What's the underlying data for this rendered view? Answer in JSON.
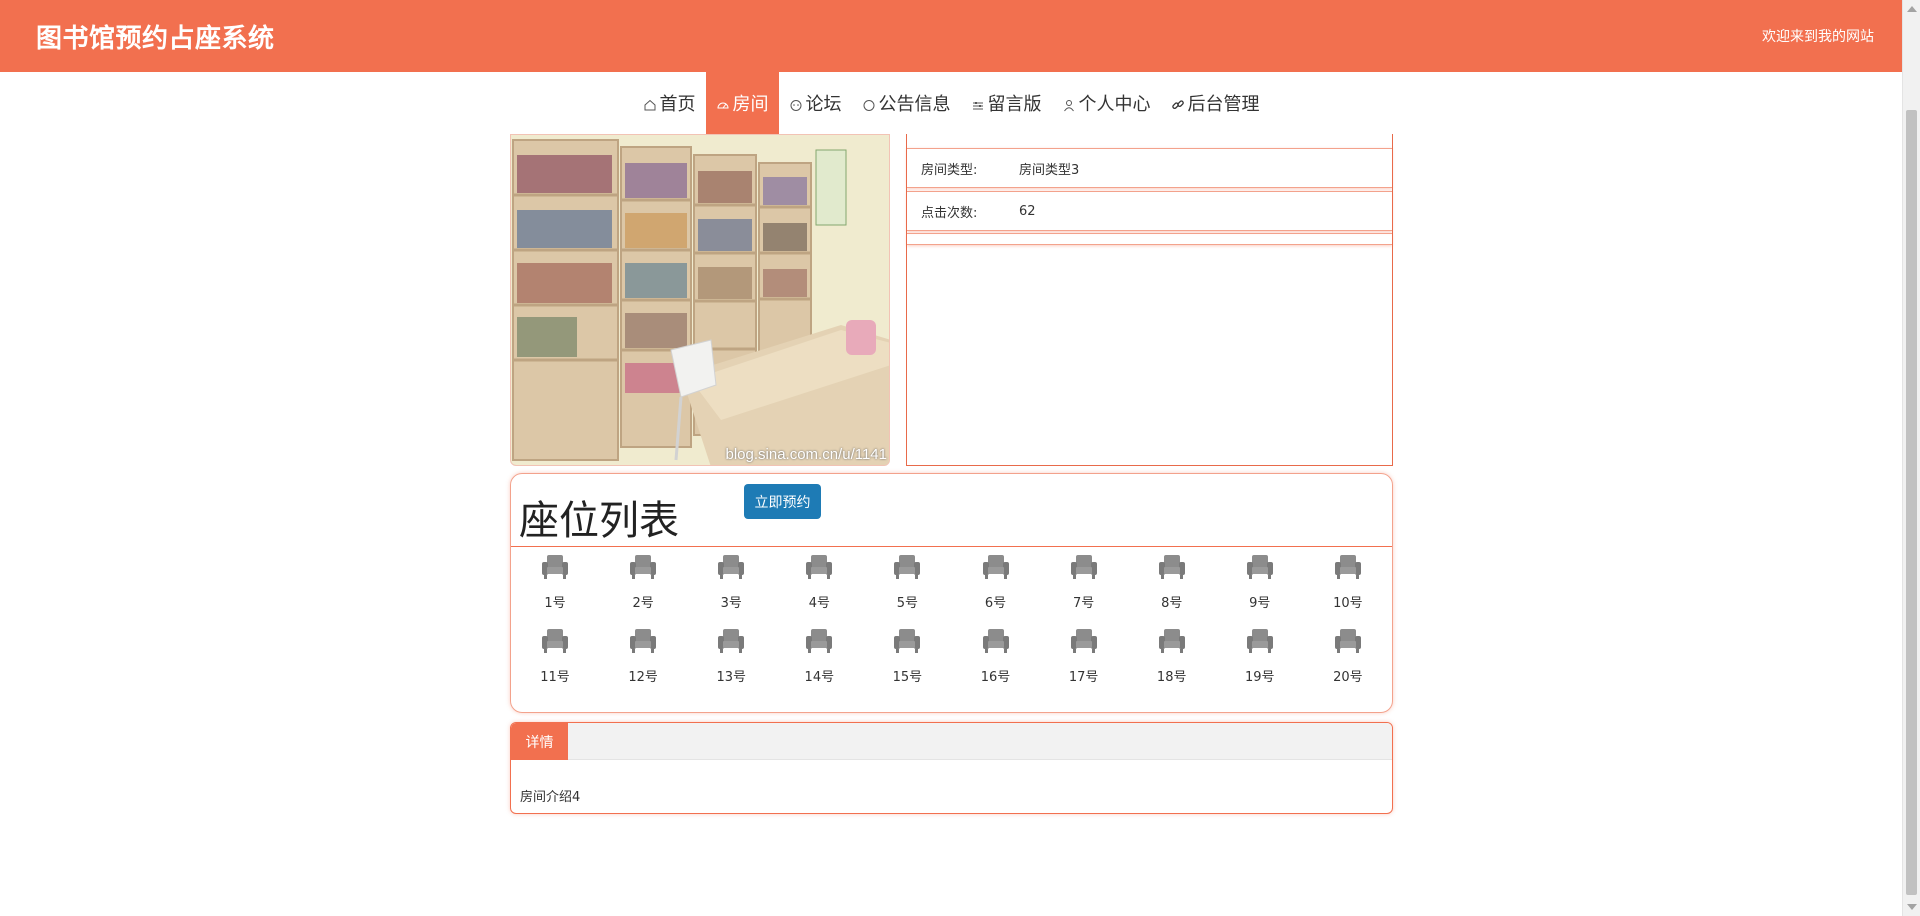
{
  "header": {
    "site_title": "图书馆预约占座系统",
    "welcome": "欢迎来到我的网站"
  },
  "nav": {
    "items": [
      {
        "label": "首页",
        "icon": "home-icon",
        "active": false
      },
      {
        "label": "房间",
        "icon": "dashboard-icon",
        "active": true
      },
      {
        "label": "论坛",
        "icon": "forum-icon",
        "active": false
      },
      {
        "label": "公告信息",
        "icon": "circle-icon",
        "active": false
      },
      {
        "label": "留言版",
        "icon": "sliders-icon",
        "active": false
      },
      {
        "label": "个人中心",
        "icon": "user-icon",
        "active": false
      },
      {
        "label": "后台管理",
        "icon": "link-icon",
        "active": false
      }
    ]
  },
  "room": {
    "image_watermark": "blog.sina.com.cn/u/1141",
    "info": [
      {
        "label": "房间类型:",
        "value": "房间类型3"
      },
      {
        "label": "点击次数:",
        "value": "62"
      }
    ]
  },
  "seats": {
    "title": "座位列表",
    "reserve_button": "立即预约",
    "list": [
      "1号",
      "2号",
      "3号",
      "4号",
      "5号",
      "6号",
      "7号",
      "8号",
      "9号",
      "10号",
      "11号",
      "12号",
      "13号",
      "14号",
      "15号",
      "16号",
      "17号",
      "18号",
      "19号",
      "20号"
    ]
  },
  "detail": {
    "tab_label": "详情",
    "text": "房间介绍4"
  },
  "colors": {
    "brand": "#f2704f",
    "button": "#1e7bb5"
  }
}
